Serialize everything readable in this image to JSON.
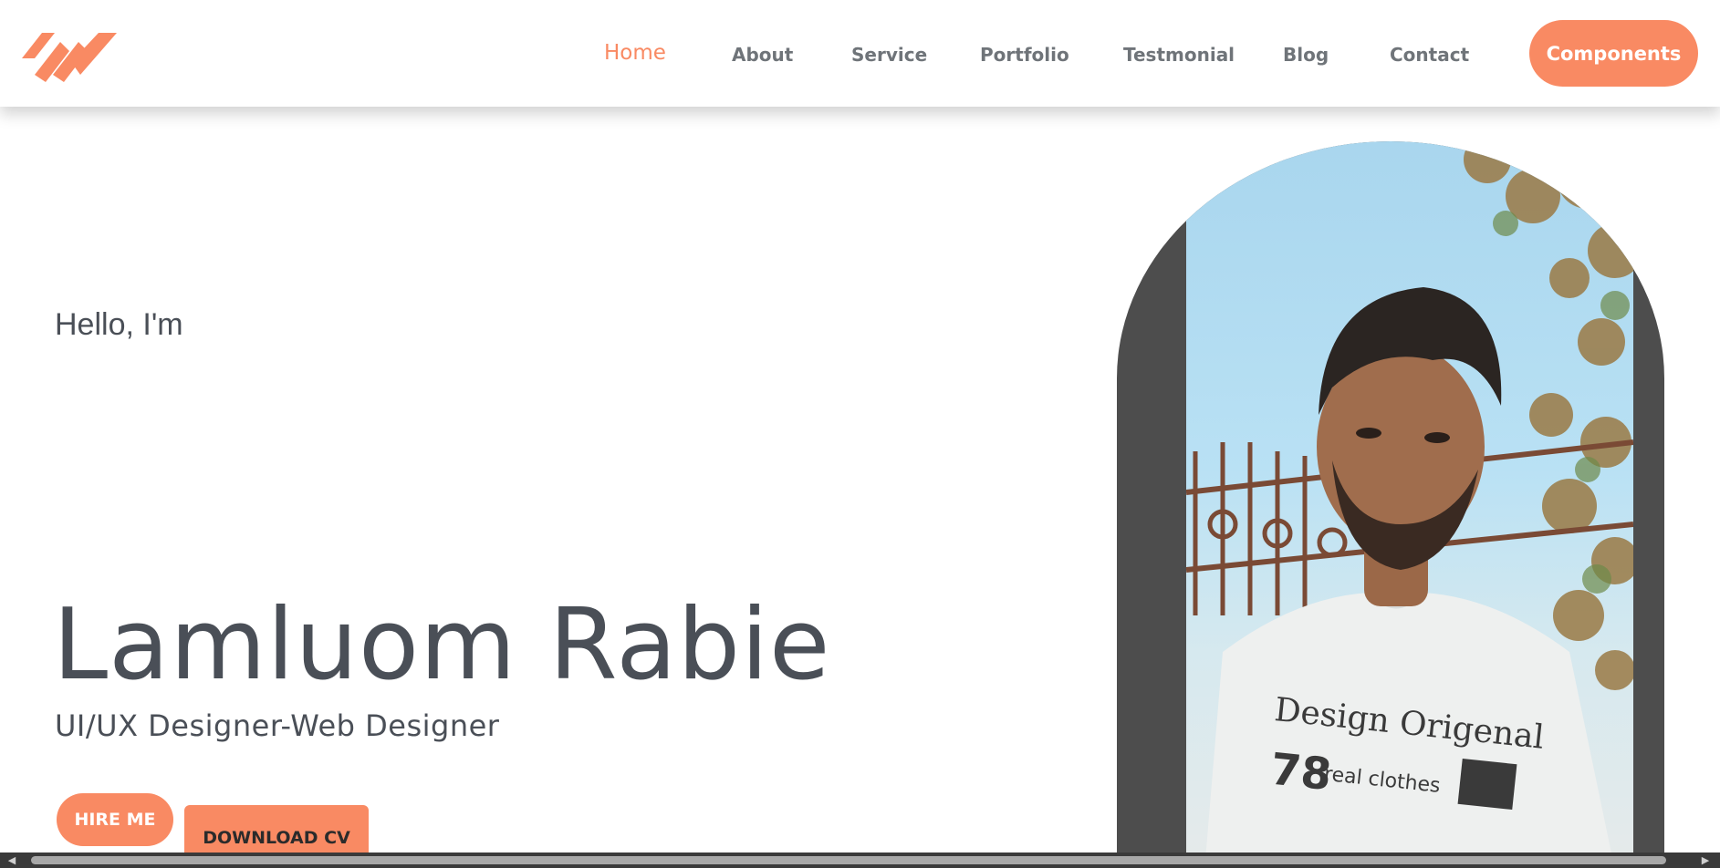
{
  "nav": {
    "items": [
      {
        "label": "Home",
        "active": true
      },
      {
        "label": "About"
      },
      {
        "label": "Service"
      },
      {
        "label": "Portfolio"
      },
      {
        "label": "Testmonial"
      },
      {
        "label": "Blog"
      },
      {
        "label": "Contact"
      }
    ],
    "cta_label": "Components"
  },
  "hero": {
    "greeting": "Hello, I'm",
    "name": "Lamluom Rabie",
    "role": "UI/UX Designer-Web Designer",
    "hire_label": "HIRE ME",
    "cv_label": "DOWNLOAD CV"
  },
  "colors": {
    "accent": "#f98a63",
    "text": "#4a4f57",
    "frame": "#4d4d4d"
  }
}
